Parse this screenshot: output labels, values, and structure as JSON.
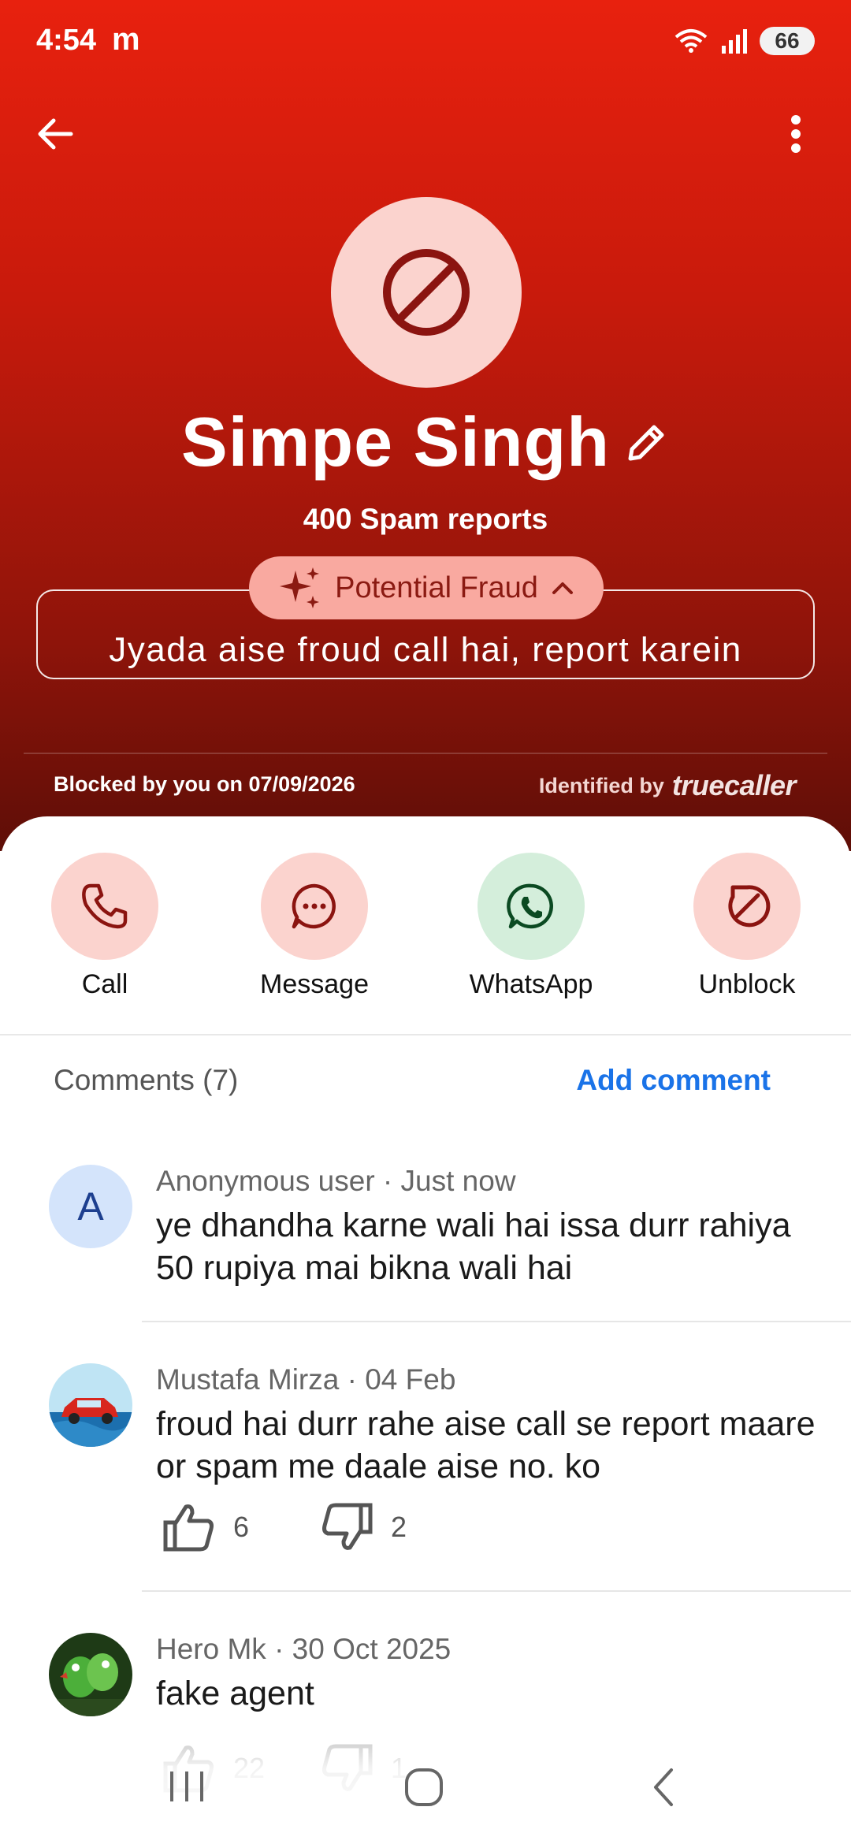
{
  "status_bar": {
    "time": "4:54",
    "carrier_glyph": "m",
    "battery": "66"
  },
  "contact": {
    "name": "Simpe Singh",
    "spam_reports": "400 Spam reports",
    "fraud_label": "Potential Fraud",
    "fraud_summary": "Jyada aise froud call hai, report karein",
    "blocked_text": "Blocked by you on 07/09/2026",
    "identified_by": "Identified by",
    "brand": "truecaller"
  },
  "actions": [
    {
      "label": "Call",
      "icon": "phone-icon"
    },
    {
      "label": "Message",
      "icon": "message-icon"
    },
    {
      "label": "WhatsApp",
      "icon": "whatsapp-icon"
    },
    {
      "label": "Unblock",
      "icon": "unblock-icon"
    }
  ],
  "comments": {
    "title": "Comments (7)",
    "add_label": "Add comment",
    "items": [
      {
        "avatar_letter": "A",
        "meta": "Anonymous user · Just now",
        "text": "ye dhandha karne wali hai issa durr rahiya 50 rupiya mai  bikna wali hai"
      },
      {
        "meta": "Mustafa Mirza · 04 Feb",
        "text": "froud hai durr rahe aise call se report maare or spam me daale aise no. ko",
        "likes": "6",
        "dislikes": "2"
      },
      {
        "meta": "Hero Mk · 30 Oct 2025",
        "text": "fake agent",
        "likes": "22",
        "dislikes": "1"
      }
    ]
  },
  "colors": {
    "header_top": "#e8210e",
    "header_bottom": "#5e0e07",
    "action_red_bg": "#fbd3ce",
    "action_green_bg": "#d4eedb",
    "link_blue": "#1a73e8"
  }
}
